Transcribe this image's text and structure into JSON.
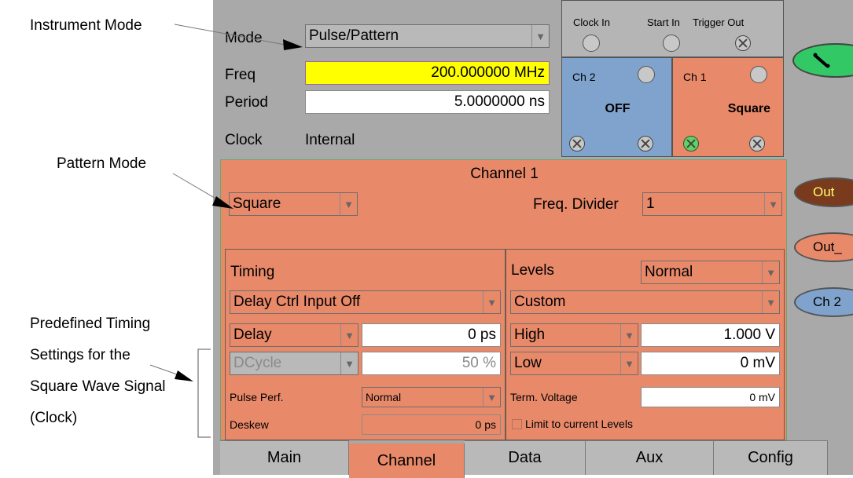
{
  "callouts": {
    "instrument_mode": "Instrument Mode",
    "pattern_mode": "Pattern Mode",
    "predefined": [
      "Predefined Timing",
      "Settings for the",
      "Square Wave Signal",
      "(Clock)"
    ]
  },
  "top": {
    "mode_label": "Mode",
    "mode_value": "Pulse/Pattern",
    "freq_label": "Freq",
    "freq_value": "200.000000 MHz",
    "period_label": "Period",
    "period_value": "5.0000000 ns",
    "clock_label": "Clock",
    "clock_value": "Internal"
  },
  "io": {
    "clock_in": "Clock In",
    "start_in": "Start In",
    "trigger_out": "Trigger Out"
  },
  "ch2_box": {
    "label": "Ch 2",
    "status": "OFF"
  },
  "ch1_box": {
    "label": "Ch 1",
    "status": "Square"
  },
  "channel": {
    "title": "Channel 1",
    "pattern_value": "Square",
    "freq_divider_label": "Freq. Divider",
    "freq_divider_value": "1"
  },
  "timing": {
    "title": "Timing",
    "delay_ctrl": "Delay Ctrl Input Off",
    "delay_label": "Delay",
    "delay_value": "0 ps",
    "dcycle_label": "DCycle",
    "dcycle_value": "50 %",
    "pulse_perf_label": "Pulse Perf.",
    "pulse_perf_value": "Normal",
    "deskew_label": "Deskew",
    "deskew_value": "0 ps"
  },
  "levels": {
    "title": "Levels",
    "mode_value": "Normal",
    "custom_value": "Custom",
    "high_label": "High",
    "high_value": "1.000 V",
    "low_label": "Low",
    "low_value": "0 mV",
    "term_label": "Term. Voltage",
    "term_value": "0 mV",
    "limit_label": "Limit to current Levels"
  },
  "side": {
    "out": "Out",
    "out_neg": "Out_",
    "ch2": "Ch 2"
  },
  "tabs": [
    "Main",
    "Channel",
    "Data",
    "Aux",
    "Config"
  ],
  "colors": {
    "panel_gray": "#a9a9a9",
    "channel_orange": "#e8896a",
    "ch2_blue": "#7fa3cc",
    "freq_yellow": "#ffff00",
    "green_button": "#33c866",
    "out_brown": "#7a3a1e"
  }
}
